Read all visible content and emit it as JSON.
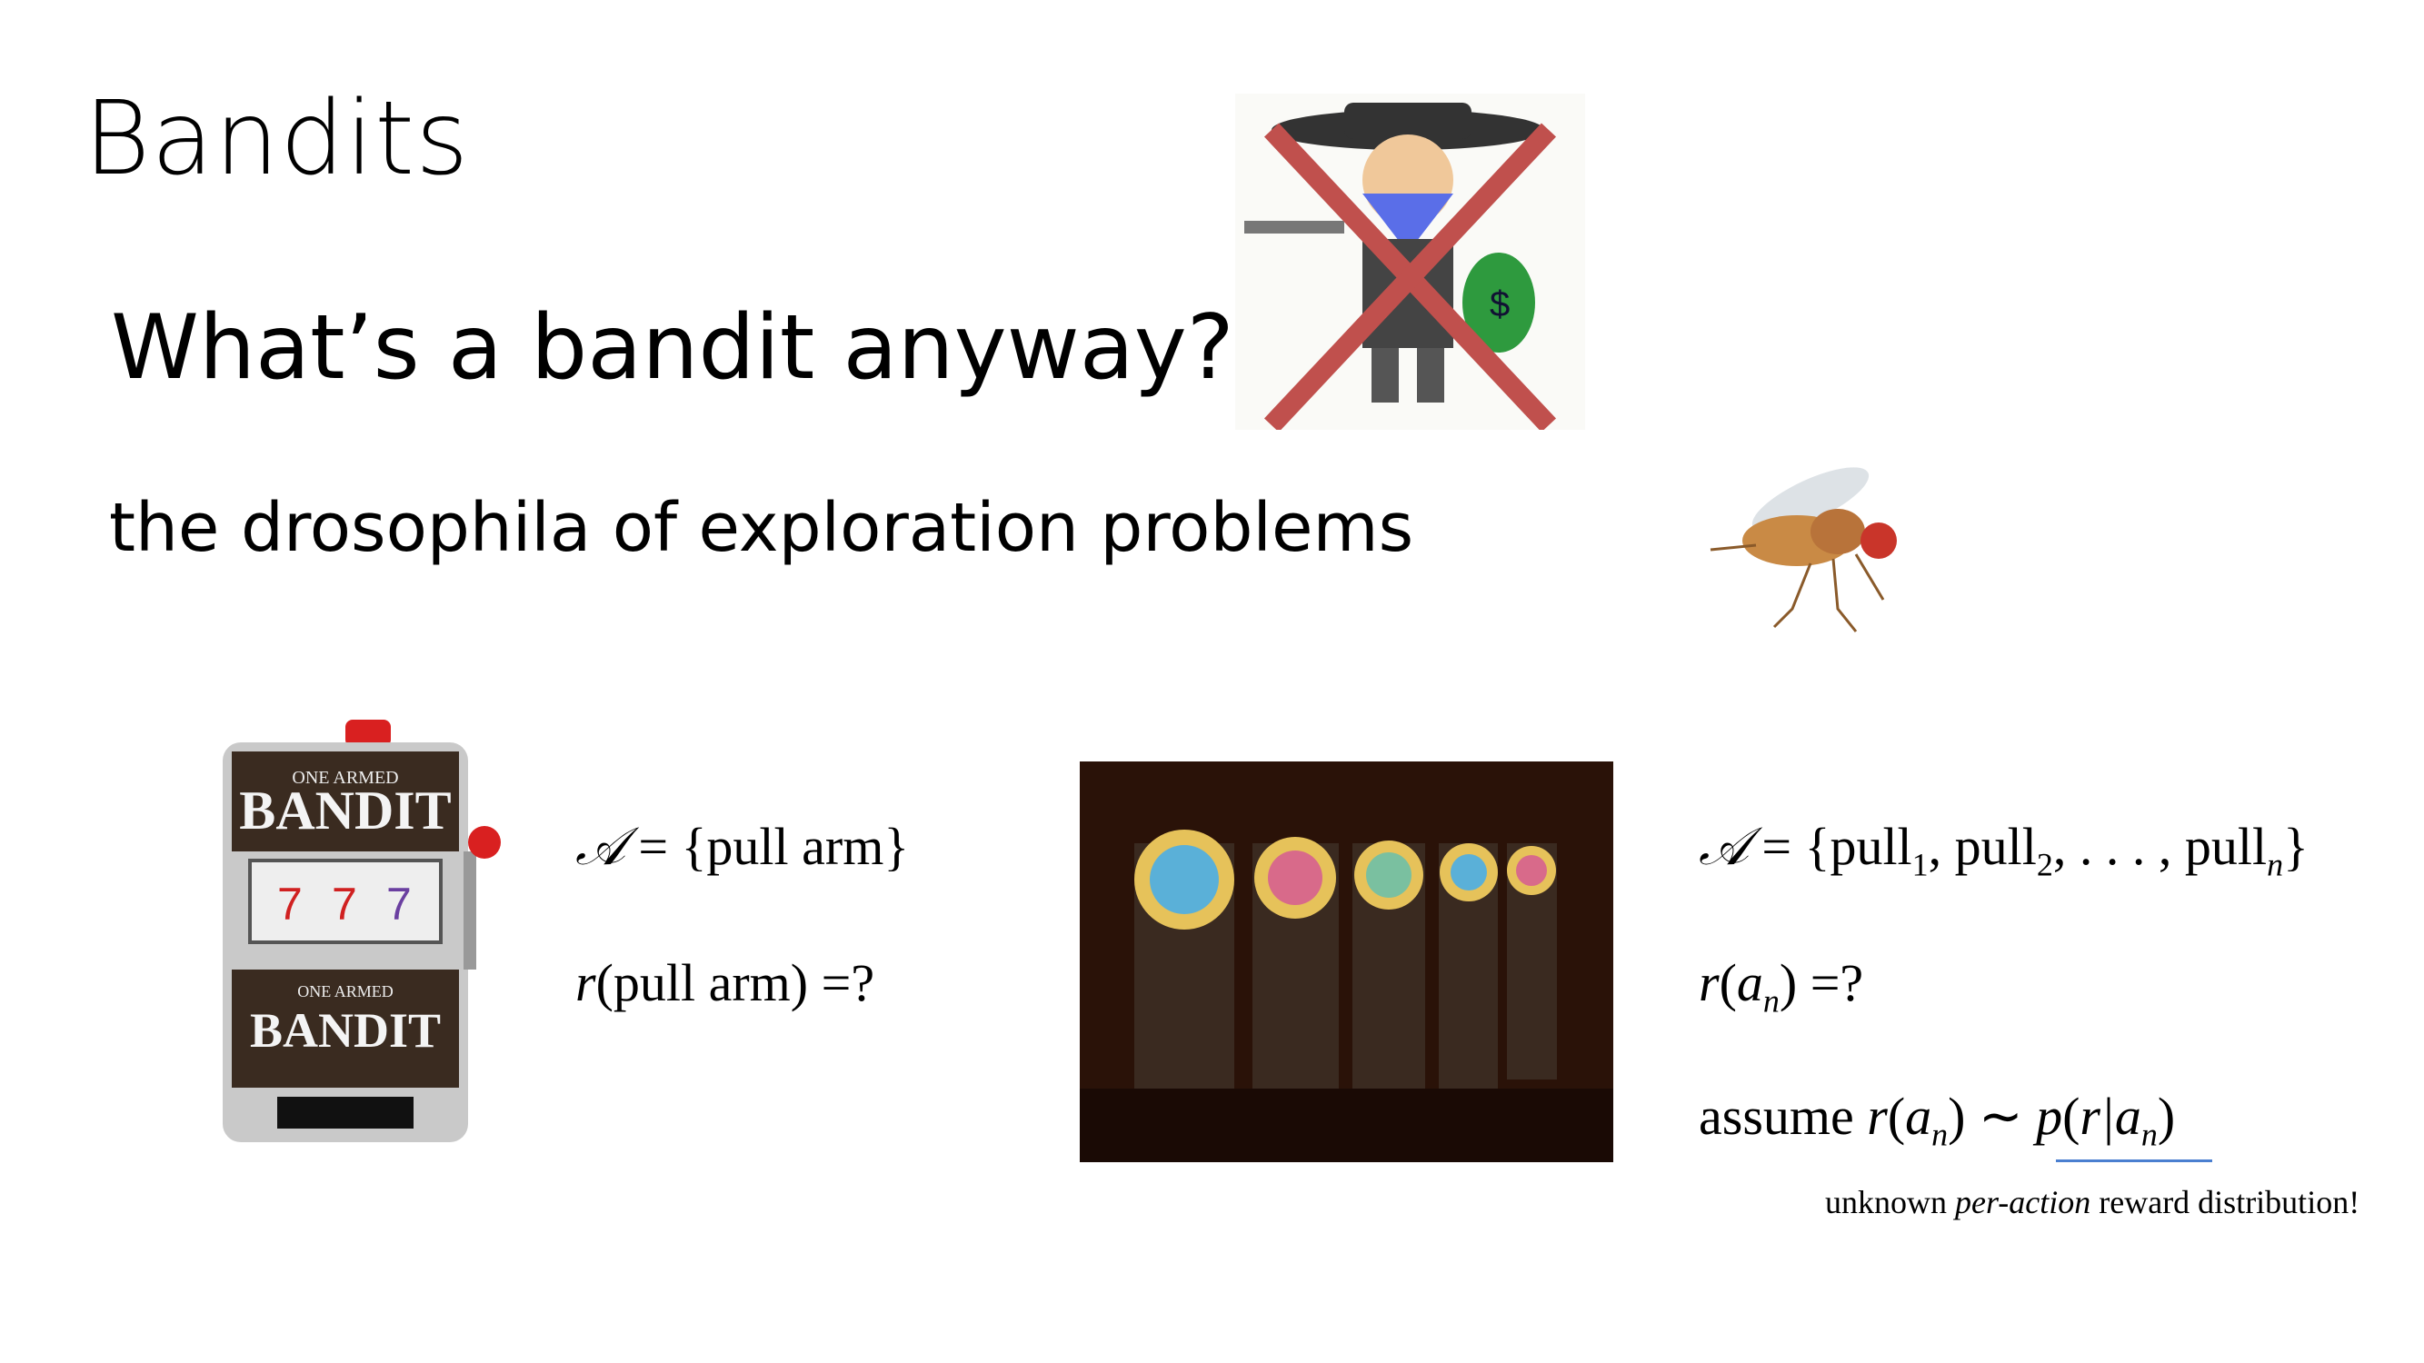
{
  "slide": {
    "title": "Bandits",
    "heading": "What’s a bandit anyway?",
    "subtitle": "the drosophila of exploration problems"
  },
  "left_math": {
    "action_set": {
      "lhs": "𝒜",
      "eq": " = ",
      "rhs": "{pull arm}"
    },
    "reward": {
      "r": "r",
      "arg": "(pull arm)",
      "rest": " =?"
    }
  },
  "right_math": {
    "action_set": {
      "lhs": "𝒜",
      "eq": " = {",
      "items": [
        "pull",
        "pull",
        "pull"
      ],
      "subs": [
        "1",
        "2",
        "n"
      ],
      "sep": ", ",
      "ellipsis": ". . . , ",
      "close": "}"
    },
    "reward": {
      "r": "r",
      "open": "(",
      "a": "a",
      "sub": "n",
      "close": ") =?"
    },
    "assume": {
      "word": "assume ",
      "r": "r",
      "a": "a",
      "sub": "n",
      "tilde": ") ∼ ",
      "p": "p",
      "cond": "r|",
      "close": ")"
    }
  },
  "note": {
    "pre": "unknown ",
    "em": "per-action",
    "post": " reward distribution!"
  },
  "images": {
    "slot_machine_label_top": "ONE ARMED",
    "slot_machine_label": "BANDIT",
    "crossed_out_color": "#c0504d",
    "underline_color": "#4a7fd0"
  }
}
